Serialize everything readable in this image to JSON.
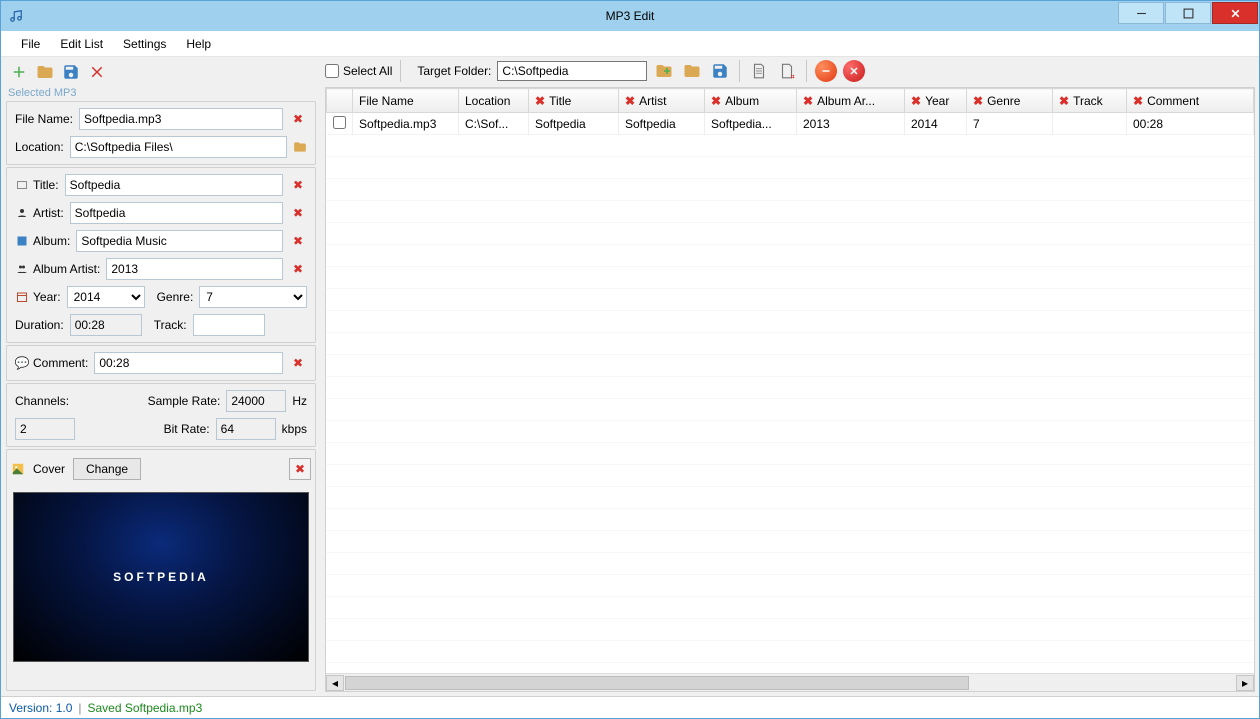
{
  "window_title": "MP3 Edit",
  "menu": {
    "file": "File",
    "edit_list": "Edit List",
    "settings": "Settings",
    "help": "Help"
  },
  "left": {
    "group_label": "Selected MP3",
    "file_name_label": "File Name:",
    "file_name": "Softpedia.mp3",
    "location_label": "Location:",
    "location": "C:\\Softpedia Files\\",
    "title_label": "Title:",
    "title": "Softpedia",
    "artist_label": "Artist:",
    "artist": "Softpedia",
    "album_label": "Album:",
    "album": "Softpedia Music",
    "album_artist_label": "Album Artist:",
    "album_artist": "2013",
    "year_label": "Year:",
    "year": "2014",
    "genre_label": "Genre:",
    "genre": "7",
    "duration_label": "Duration:",
    "duration": "00:28",
    "track_label": "Track:",
    "track": "",
    "comment_label": "Comment:",
    "comment": "00:28",
    "channels_label": "Channels:",
    "channels": "2",
    "sample_rate_label": "Sample Rate:",
    "sample_rate": "24000",
    "hz": "Hz",
    "bit_rate_label": "Bit Rate:",
    "bit_rate": "64",
    "kbps": "kbps",
    "cover_label": "Cover",
    "change_btn": "Change",
    "cover_text": "SOFTPEDIA"
  },
  "right_toolbar": {
    "select_all": "Select All",
    "target_folder_label": "Target Folder:",
    "target_folder": "C:\\Softpedia"
  },
  "table": {
    "headers": {
      "chk": "",
      "file_name": "File Name",
      "location": "Location",
      "title": "Title",
      "artist": "Artist",
      "album": "Album",
      "album_artist": "Album Ar...",
      "year": "Year",
      "genre": "Genre",
      "track": "Track",
      "comment": "Comment"
    },
    "rows": [
      {
        "file_name": "Softpedia.mp3",
        "location": "C:\\Sof...",
        "title": "Softpedia",
        "artist": "Softpedia",
        "album": "Softpedia...",
        "album_artist": "2013",
        "year": "2014",
        "genre": "7",
        "track": "",
        "comment": "00:28"
      }
    ]
  },
  "status": {
    "version": "Version:  1.0",
    "saved": "Saved Softpedia.mp3"
  }
}
